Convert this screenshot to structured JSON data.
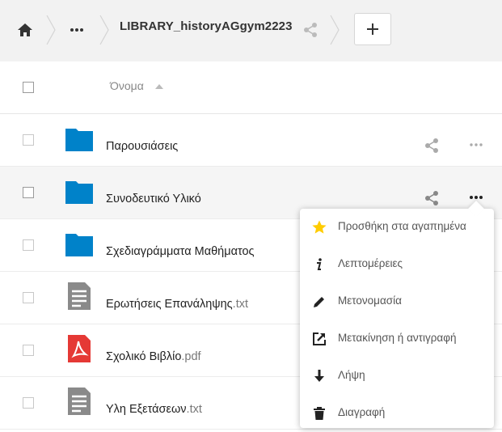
{
  "breadcrumb": {
    "home_icon": "home-icon",
    "more_icon": "more-horizontal-icon",
    "current_folder": "LIBRARY_historyAGgym2223",
    "share_icon": "share-icon",
    "new_button_icon": "plus-icon"
  },
  "file_list": {
    "header_name": "Όνομα",
    "sort_icon": "sort-ascending-icon"
  },
  "files": [
    {
      "name": "Παρουσιάσεις",
      "ext": "",
      "type": "folder"
    },
    {
      "name": "Συνοδευτικό Υλικό",
      "ext": "",
      "type": "folder"
    },
    {
      "name": "Σχεδιαγράμματα Μαθήματος",
      "ext": "",
      "type": "folder"
    },
    {
      "name": "Ερωτήσεις Επανάληψης",
      "ext": ".txt",
      "type": "text"
    },
    {
      "name": "Σχολικό Βιβλίο",
      "ext": ".pdf",
      "type": "pdf"
    },
    {
      "name": "Υλη Εξετάσεων",
      "ext": ".txt",
      "type": "text"
    }
  ],
  "context_menu": {
    "items": [
      {
        "label": "Προσθήκη στα αγαπημένα",
        "icon": "star-icon"
      },
      {
        "label": "Λεπτομέρειες",
        "icon": "info-icon"
      },
      {
        "label": "Μετονομασία",
        "icon": "pencil-icon"
      },
      {
        "label": "Μετακίνηση ή αντιγραφή",
        "icon": "move-icon"
      },
      {
        "label": "Λήψη",
        "icon": "download-icon"
      },
      {
        "label": "Διαγραφή",
        "icon": "trash-icon"
      }
    ]
  },
  "colors": {
    "folder": "#0082c9",
    "star": "#fc0",
    "pdf": "#e53935",
    "text_file": "#8a8a8a"
  }
}
